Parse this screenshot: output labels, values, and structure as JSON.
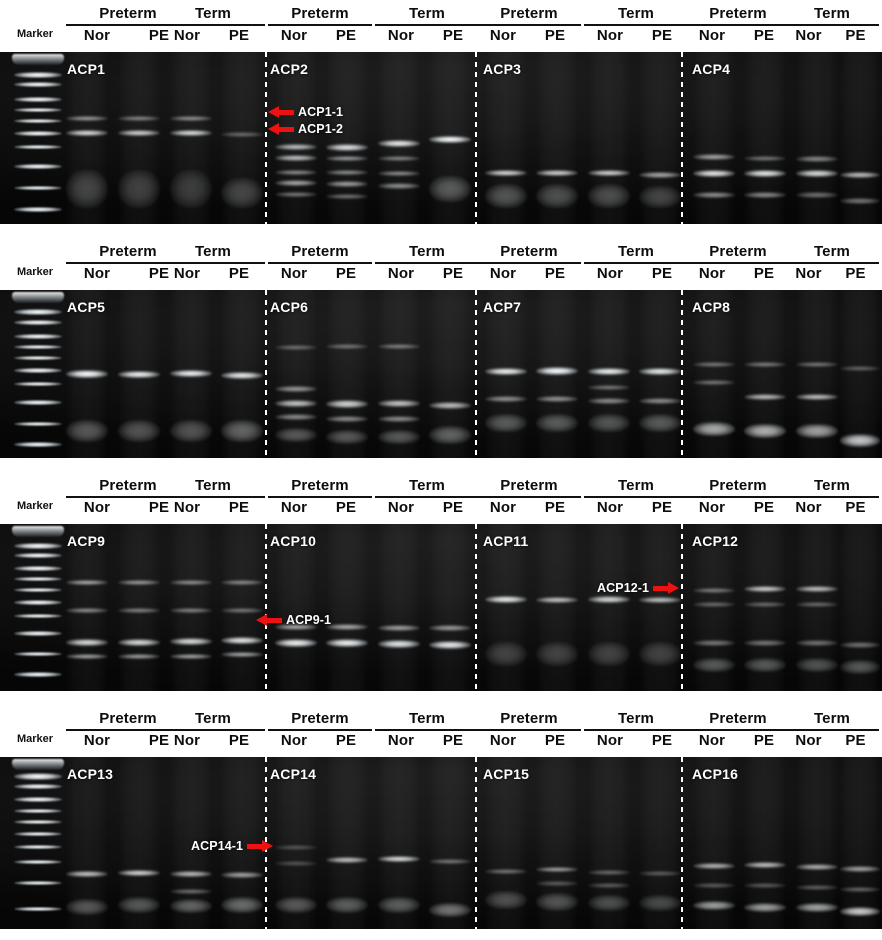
{
  "figure": {
    "marker_label": "Marker",
    "group_labels": [
      "Preterm",
      "Term"
    ],
    "sample_labels": [
      "Nor",
      "PE"
    ],
    "accent_arrow_color": "#ee1111",
    "gel_background_color": "#0a0a0a",
    "band_color": "#ffffff",
    "divider_color": "#ffffff"
  },
  "rows": [
    {
      "id": "row-1",
      "panels": [
        {
          "title": "ACP1"
        },
        {
          "title": "ACP2"
        },
        {
          "title": "ACP3"
        },
        {
          "title": "ACP4"
        }
      ],
      "annotations": [
        {
          "label": "ACP1-1",
          "direction": "left"
        },
        {
          "label": "ACP1-2",
          "direction": "left"
        }
      ]
    },
    {
      "id": "row-2",
      "panels": [
        {
          "title": "ACP5"
        },
        {
          "title": "ACP6"
        },
        {
          "title": "ACP7"
        },
        {
          "title": "ACP8"
        }
      ],
      "annotations": []
    },
    {
      "id": "row-3",
      "panels": [
        {
          "title": "ACP9"
        },
        {
          "title": "ACP10"
        },
        {
          "title": "ACP11"
        },
        {
          "title": "ACP12"
        }
      ],
      "annotations": [
        {
          "label": "ACP9-1",
          "direction": "left"
        },
        {
          "label": "ACP12-1",
          "direction": "right"
        }
      ]
    },
    {
      "id": "row-4",
      "panels": [
        {
          "title": "ACP13"
        },
        {
          "title": "ACP14"
        },
        {
          "title": "ACP15"
        },
        {
          "title": "ACP16"
        }
      ],
      "annotations": [
        {
          "label": "ACP14-1",
          "direction": "right"
        }
      ]
    }
  ]
}
